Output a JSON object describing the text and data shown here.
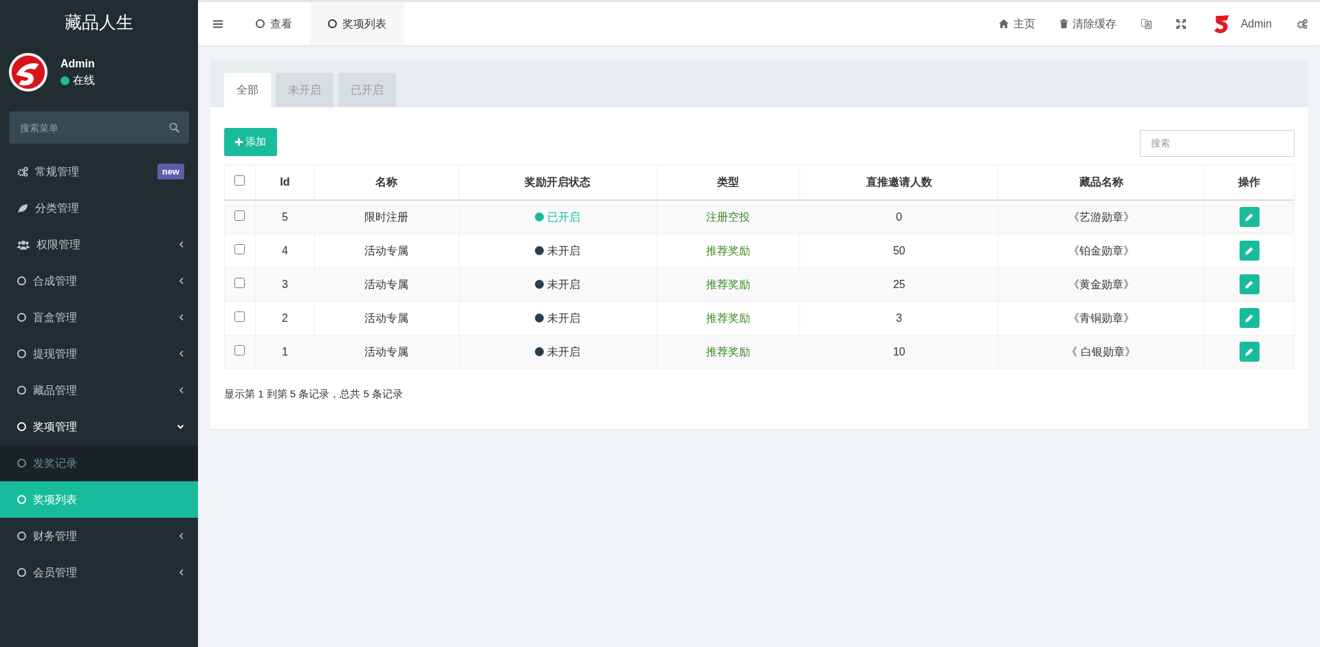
{
  "sidebar": {
    "title": "藏品人生",
    "user": {
      "name": "Admin",
      "status": "在线"
    },
    "search": {
      "placeholder": "搜索菜单"
    },
    "items": [
      {
        "label": "常规管理",
        "kind": "gears",
        "badge": "new",
        "expandable": false,
        "expanded": false,
        "selected": false
      },
      {
        "label": "分类管理",
        "kind": "leaf",
        "expandable": false,
        "expanded": false,
        "selected": false
      },
      {
        "label": "权限管理",
        "kind": "users",
        "expandable": true,
        "expanded": false,
        "selected": false
      },
      {
        "label": "合成管理",
        "kind": "circle",
        "expandable": true,
        "expanded": false,
        "selected": false
      },
      {
        "label": "盲盒管理",
        "kind": "circle",
        "expandable": true,
        "expanded": false,
        "selected": false
      },
      {
        "label": "提现管理",
        "kind": "circle",
        "expandable": true,
        "expanded": false,
        "selected": false
      },
      {
        "label": "藏品管理",
        "kind": "circle",
        "expandable": true,
        "expanded": false,
        "selected": false
      },
      {
        "label": "奖项管理",
        "kind": "circle",
        "expandable": true,
        "expanded": true,
        "selected": true,
        "children": [
          {
            "label": "发奖记录",
            "selected": false
          },
          {
            "label": "奖项列表",
            "selected": true
          }
        ]
      },
      {
        "label": "财务管理",
        "kind": "circle",
        "expandable": true,
        "expanded": false,
        "selected": false
      },
      {
        "label": "会员管理",
        "kind": "circle",
        "expandable": true,
        "expanded": false,
        "selected": false
      }
    ]
  },
  "topbar": {
    "tabs": [
      {
        "label": "查看",
        "selected": false
      },
      {
        "label": "奖项列表",
        "selected": true
      }
    ],
    "links": [
      {
        "kind": "home",
        "label": "主页"
      },
      {
        "kind": "trash",
        "label": "清除缓存"
      },
      {
        "kind": "translate"
      },
      {
        "kind": "fullscreen"
      }
    ],
    "user": {
      "name": "Admin"
    }
  },
  "panel": {
    "tabs": [
      {
        "label": "全部",
        "selected": true
      },
      {
        "label": "未开启",
        "selected": false
      },
      {
        "label": "已开启",
        "selected": false
      }
    ],
    "add_button": "添加",
    "search": {
      "placeholder": "搜索"
    },
    "table": {
      "header_checked": false,
      "columns": [
        "Id",
        "名称",
        "奖励开启状态",
        "类型",
        "直推邀请人数",
        "藏品名称",
        "操作"
      ],
      "rows": [
        {
          "checked": false,
          "id": "5",
          "name": "限时注册",
          "status": {
            "label": "已开启",
            "on": true
          },
          "type": "注册空投",
          "invites": "0",
          "item": "《艺游勋章》"
        },
        {
          "checked": false,
          "id": "4",
          "name": "活动专属",
          "status": {
            "label": "未开启",
            "on": false
          },
          "type": "推荐奖励",
          "invites": "50",
          "item": "《铂金勋章》"
        },
        {
          "checked": false,
          "id": "3",
          "name": "活动专属",
          "status": {
            "label": "未开启",
            "on": false
          },
          "type": "推荐奖励",
          "invites": "25",
          "item": "《黄金勋章》"
        },
        {
          "checked": false,
          "id": "2",
          "name": "活动专属",
          "status": {
            "label": "未开启",
            "on": false
          },
          "type": "推荐奖励",
          "invites": "3",
          "item": "《青铜勋章》"
        },
        {
          "checked": false,
          "id": "1",
          "name": "活动专属",
          "status": {
            "label": "未开启",
            "on": false
          },
          "type": "推荐奖励",
          "invites": "10",
          "item": "《 白银勋章》"
        }
      ]
    },
    "footer": "显示第 1 到第 5 条记录，总共 5 条记录"
  }
}
